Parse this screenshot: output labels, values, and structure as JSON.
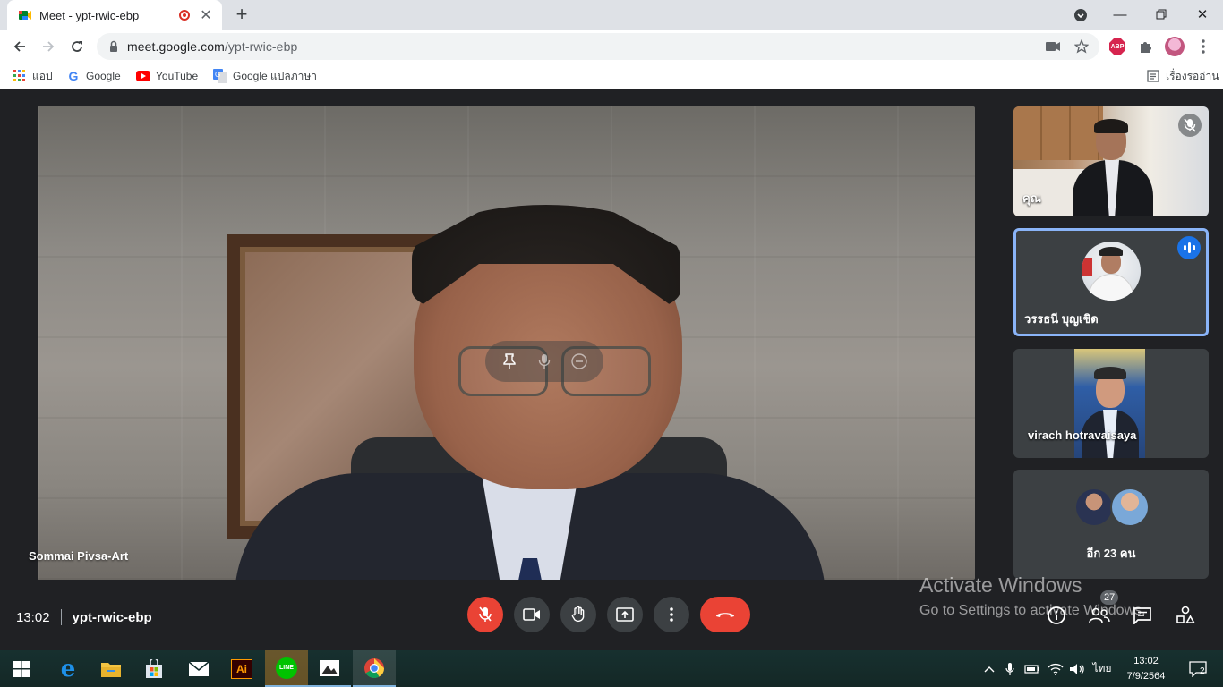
{
  "browser": {
    "tab_title": "Meet - ypt-rwic-ebp",
    "url_host": "meet.google.com",
    "url_path": "/ypt-rwic-ebp",
    "new_tab_label": "+",
    "bookmarks": [
      {
        "label": "แอป",
        "icon": "apps-grid-icon"
      },
      {
        "label": "Google",
        "icon": "google-icon"
      },
      {
        "label": "YouTube",
        "icon": "youtube-icon"
      },
      {
        "label": "Google แปลภาษา",
        "icon": "google-translate-icon"
      }
    ],
    "reading_list_label": "เรื่องรออ่าน",
    "ext_abp_label": "ABP"
  },
  "meet": {
    "main_speaker": "Sommai Pivsa-Art",
    "tiles": [
      {
        "label": "คุณ"
      },
      {
        "label": "วรรธนี บุญเชิด"
      },
      {
        "label": "virach hotravaisaya"
      },
      {
        "label": "อีก 23 คน"
      }
    ],
    "time": "13:02",
    "meeting_code": "ypt-rwic-ebp",
    "participants_count": "27",
    "activate_title": "Activate Windows",
    "activate_subtitle": "Go to Settings to activate Windows."
  },
  "taskbar": {
    "apps": [
      "windows-start-icon",
      "edge-icon",
      "file-explorer-icon",
      "store-icon",
      "mail-icon",
      "illustrator-icon",
      "line-icon",
      "photos-icon",
      "chrome-icon"
    ],
    "illustrator_label": "Ai",
    "line_label": "LINE",
    "language": "ไทย",
    "time": "13:02",
    "date": "7/9/2564",
    "notifications": "2"
  },
  "colors": {
    "meet_bg": "#202124",
    "red": "#ea4335",
    "blue_accent": "#8ab4f8",
    "taskbar": "#17302f"
  }
}
